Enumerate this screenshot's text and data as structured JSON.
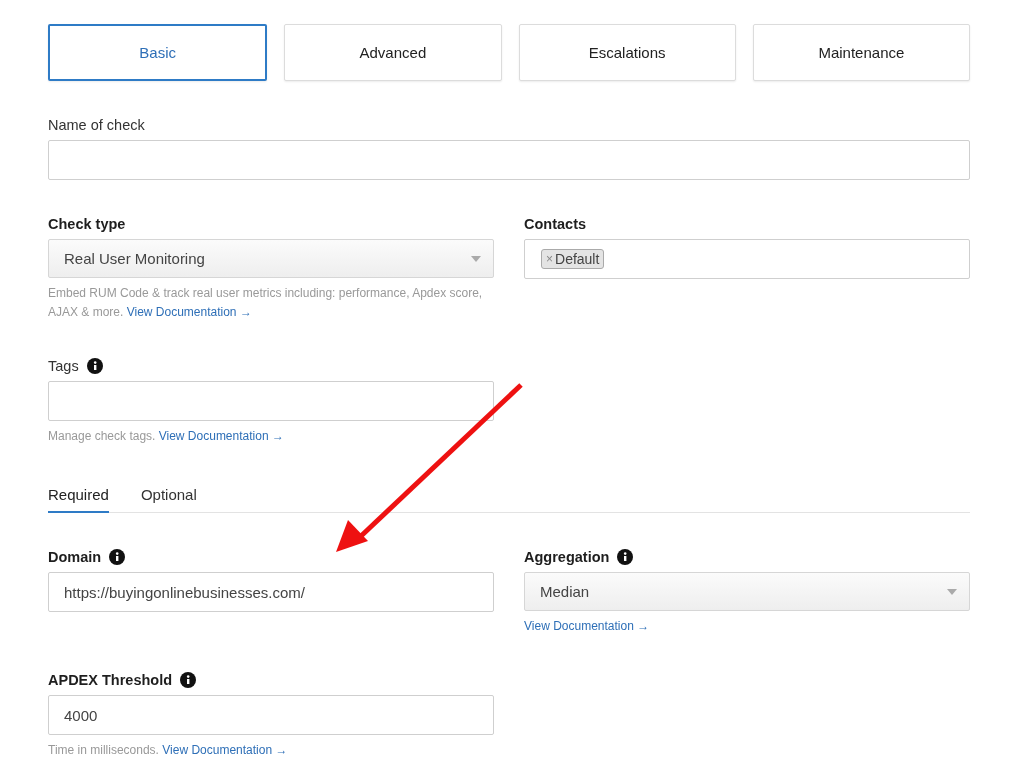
{
  "tabs": [
    {
      "label": "Basic",
      "selected": true
    },
    {
      "label": "Advanced",
      "selected": false
    },
    {
      "label": "Escalations",
      "selected": false
    },
    {
      "label": "Maintenance",
      "selected": false
    }
  ],
  "top_rows": [
    [
      {
        "kind": "text",
        "label": "Name of check",
        "bold": false,
        "info": false,
        "wide": true
      }
    ],
    [
      {
        "kind": "select",
        "label": "Check type",
        "bold": true,
        "info": false,
        "value": "Real User Monitoring",
        "help": "Embed RUM Code & track real user metrics including: performance, Apdex score, AJAX & more.",
        "link": "View Documentation →"
      },
      {
        "kind": "chips",
        "label": "Contacts",
        "bold": true,
        "info": false,
        "chips": [
          {
            "remove": "×",
            "label": "Default"
          }
        ]
      }
    ],
    [
      {
        "kind": "text",
        "label": "Tags",
        "bold": false,
        "info": true,
        "help": "Manage check tags.",
        "link": "View Documentation →"
      }
    ]
  ],
  "subtabs": [
    {
      "label": "Required",
      "selected": true
    },
    {
      "label": "Optional",
      "selected": false
    }
  ],
  "tab_rows": [
    [
      {
        "kind": "text",
        "label": "Domain",
        "bold": true,
        "info": true,
        "value": "https://buyingonlinebusinesses.com/"
      },
      {
        "kind": "select",
        "label": "Aggregation",
        "bold": true,
        "info": true,
        "value": "Median",
        "link": "View Documentation →"
      }
    ],
    [
      {
        "kind": "text",
        "label": "APDEX Threshold",
        "bold": true,
        "info": true,
        "value": "4000",
        "help": "Time in milliseconds.",
        "link": "View Documentation →"
      }
    ]
  ],
  "annotations": [
    {
      "kind": "arrow"
    }
  ]
}
